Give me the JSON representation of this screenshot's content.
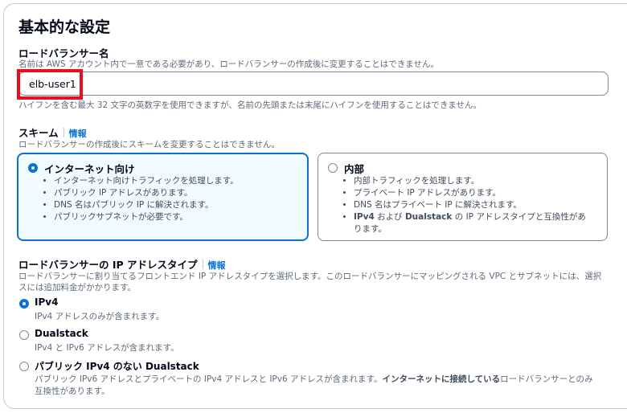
{
  "section_title": "基本的な設定",
  "lb_name": {
    "label": "ロードバランサー名",
    "description": "名前は AWS アカウント内で一意である必要があり、ロードバランサーの作成後に変更することはできません。",
    "value": "elb-user1",
    "constraint": "ハイフンを含む最大 32 文字の英数字を使用できますが、名前の先頭または末尾にハイフンを使用することはできません。"
  },
  "scheme": {
    "label": "スキーム",
    "info": "情報",
    "description": "ロードバランサーの作成後にスキームを変更することはできません。",
    "options": [
      {
        "title": "インターネット向け",
        "selected": true,
        "bullets": [
          "インターネット向けトラフィックを処理します。",
          "パブリック IP アドレスがあります。",
          "DNS 名はパブリック IP に解決されます。",
          "パブリックサブネットが必要です。"
        ]
      },
      {
        "title": "内部",
        "selected": false,
        "bullets": [
          "内部トラフィックを処理します。",
          "プライベート IP アドレスがあります。",
          "DNS 名はプライベート IP に解決されます。"
        ],
        "last_bullet_bold1": "IPv4",
        "last_bullet_text1": " および ",
        "last_bullet_bold2": "Dualstack",
        "last_bullet_text2": " の IP アドレスタイプと互換性があ",
        "last_bullet_text3": "ります。"
      }
    ]
  },
  "ip_type": {
    "label": "ロードバランサーの IP アドレスタイプ",
    "info": "情報",
    "description_line1": "ロードバランサーに割り当てるフロントエンド IP アドレスタイプを選択します。このロードバランサーにマッピングされる VPC とサブネットには、選択",
    "description_line2": "スには追加料金がかかります。",
    "options": [
      {
        "label": "IPv4",
        "description": "IPv4 アドレスのみが含まれます。",
        "selected": true
      },
      {
        "label": "Dualstack",
        "description": "IPv4 と IPv6 アドレスが含まれます。",
        "selected": false
      },
      {
        "label": "パブリック IPv4 のない Dualstack",
        "selected": false,
        "desc_part1": "パブリック IPv6 アドレスとプライベートの IPv4 アドレスと IPv6 アドレスが含まれます。",
        "desc_bold": "インターネットに接続している",
        "desc_part2": "ロードバランサーとのみ",
        "desc_line2": "互換性があります。"
      }
    ]
  },
  "colors": {
    "accent": "#0972d3",
    "highlight": "#e8101e",
    "selected_tile_bg": "#f0fbff"
  }
}
